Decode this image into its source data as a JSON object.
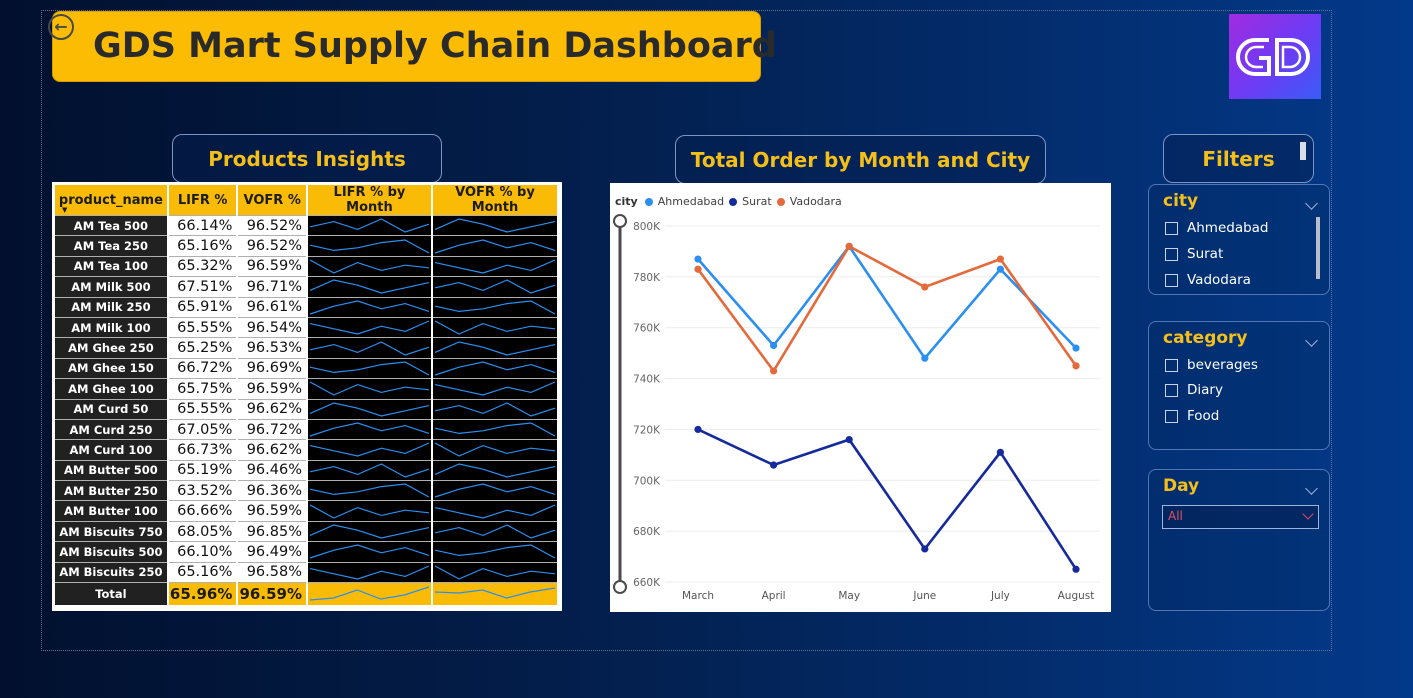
{
  "header": {
    "title": "GDS Mart Supply Chain Dashboard",
    "back_icon": "back-arrow-icon"
  },
  "sections": {
    "products": "Products Insights",
    "orders": "Total  Order by Month and City",
    "filters": "Filters"
  },
  "table": {
    "columns": [
      "product_name",
      "LIFR %",
      "VOFR %",
      "LIFR % by Month",
      "VOFR % by Month"
    ],
    "rows": [
      {
        "product": "AM Tea 500",
        "lifr": "66.14%",
        "vofr": "96.52%"
      },
      {
        "product": "AM Tea 250",
        "lifr": "65.16%",
        "vofr": "96.52%"
      },
      {
        "product": "AM Tea 100",
        "lifr": "65.32%",
        "vofr": "96.59%"
      },
      {
        "product": "AM Milk 500",
        "lifr": "67.51%",
        "vofr": "96.71%"
      },
      {
        "product": "AM Milk 250",
        "lifr": "65.91%",
        "vofr": "96.61%"
      },
      {
        "product": "AM Milk 100",
        "lifr": "65.55%",
        "vofr": "96.54%"
      },
      {
        "product": "AM Ghee 250",
        "lifr": "65.25%",
        "vofr": "96.53%"
      },
      {
        "product": "AM Ghee 150",
        "lifr": "66.72%",
        "vofr": "96.69%"
      },
      {
        "product": "AM Ghee 100",
        "lifr": "65.75%",
        "vofr": "96.59%"
      },
      {
        "product": "AM Curd 50",
        "lifr": "65.55%",
        "vofr": "96.62%"
      },
      {
        "product": "AM Curd 250",
        "lifr": "67.05%",
        "vofr": "96.72%"
      },
      {
        "product": "AM Curd 100",
        "lifr": "66.73%",
        "vofr": "96.62%"
      },
      {
        "product": "AM Butter 500",
        "lifr": "65.19%",
        "vofr": "96.46%"
      },
      {
        "product": "AM Butter 250",
        "lifr": "63.52%",
        "vofr": "96.36%"
      },
      {
        "product": "AM Butter 100",
        "lifr": "66.66%",
        "vofr": "96.59%"
      },
      {
        "product": "AM Biscuits 750",
        "lifr": "68.05%",
        "vofr": "96.85%"
      },
      {
        "product": "AM Biscuits 500",
        "lifr": "66.10%",
        "vofr": "96.49%"
      },
      {
        "product": "AM Biscuits 250",
        "lifr": "65.16%",
        "vofr": "96.58%"
      }
    ],
    "total": {
      "product": "Total",
      "lifr": "65.96%",
      "vofr": "96.59%"
    }
  },
  "chart_data": {
    "type": "line",
    "title": "Total  Order by Month and City",
    "legend_title": "city",
    "categories": [
      "March",
      "April",
      "May",
      "June",
      "July",
      "August"
    ],
    "ylim": [
      660000,
      800000
    ],
    "yticks": [
      "800K",
      "780K",
      "760K",
      "740K",
      "720K",
      "700K",
      "680K",
      "660K"
    ],
    "series": [
      {
        "name": "Ahmedabad",
        "color": "#2b8ff0",
        "values": [
          787000,
          753000,
          792000,
          748000,
          783000,
          752000
        ]
      },
      {
        "name": "Surat",
        "color": "#152a9b",
        "values": [
          720000,
          706000,
          716000,
          673000,
          711000,
          665000
        ]
      },
      {
        "name": "Vadodara",
        "color": "#e46a3b",
        "values": [
          783000,
          743000,
          792000,
          776000,
          787000,
          745000
        ]
      }
    ]
  },
  "filters": {
    "city": {
      "title": "city",
      "options": [
        "Ahmedabad",
        "Surat",
        "Vadodara"
      ]
    },
    "category": {
      "title": "category",
      "options": [
        "beverages",
        "Diary",
        "Food"
      ]
    },
    "day": {
      "title": "Day",
      "selected": "All"
    }
  }
}
